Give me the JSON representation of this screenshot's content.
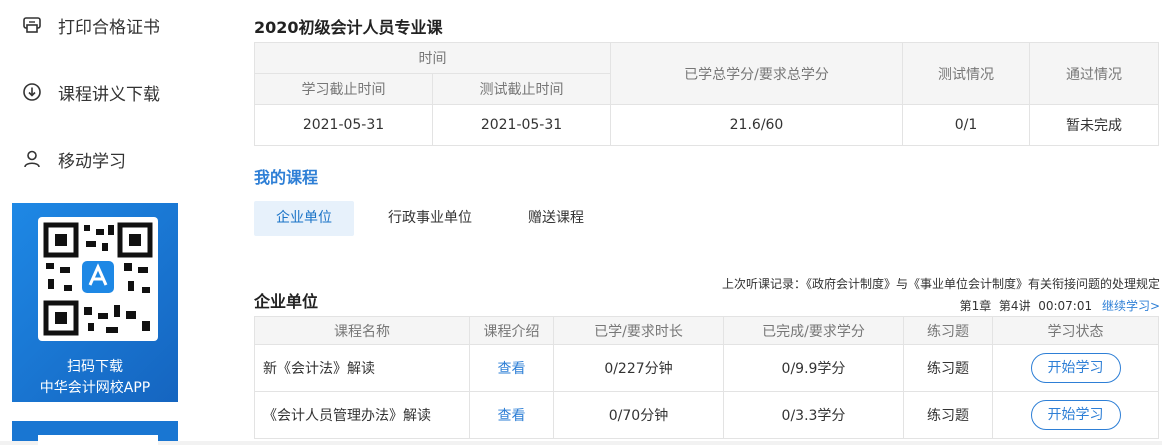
{
  "sidebar": {
    "items": [
      {
        "label": "打印合格证书",
        "icon": "printer-icon"
      },
      {
        "label": "课程讲义下载",
        "icon": "download-circle-icon"
      },
      {
        "label": "移动学习",
        "icon": "user-icon"
      }
    ],
    "qr": {
      "line1": "扫码下载",
      "line2": "中华会计网校APP"
    }
  },
  "summary": {
    "title": "2020初级会计人员专业课",
    "headers": {
      "time": "时间",
      "study_deadline": "学习截止时间",
      "test_deadline": "测试截止时间",
      "credits": "已学总学分/要求总学分",
      "test_status": "测试情况",
      "pass_status": "通过情况"
    },
    "row": {
      "study_deadline": "2021-05-31",
      "test_deadline": "2021-05-31",
      "credits": "21.6/60",
      "test_status": "0/1",
      "pass_status": "暂未完成"
    }
  },
  "my_courses": {
    "title": "我的课程",
    "tabs": [
      "企业单位",
      "行政事业单位",
      "赠送课程"
    ],
    "active_tab": 0
  },
  "course_section": {
    "title": "企业单位",
    "last_record": {
      "line1": "上次听课记录：《政府会计制度》与《事业单位会计制度》有关衔接问题的处理规定",
      "line2": "第1章  第4讲  00:07:01",
      "continue": "继续学习>"
    },
    "headers": [
      "课程名称",
      "课程介绍",
      "已学/要求时长",
      "已完成/要求学分",
      "练习题",
      "学习状态"
    ],
    "rows": [
      {
        "name": "新《会计法》解读",
        "intro": "查看",
        "duration": "0/227分钟",
        "credits": "0/9.9学分",
        "exercise": "练习题",
        "action": "开始学习"
      },
      {
        "name": "《会计人员管理办法》解读",
        "intro": "查看",
        "duration": "0/70分钟",
        "credits": "0/3.3学分",
        "exercise": "练习题",
        "action": "开始学习"
      }
    ]
  },
  "colors": {
    "accent": "#2e7fd6",
    "qr_bg": "#1e88e5"
  }
}
